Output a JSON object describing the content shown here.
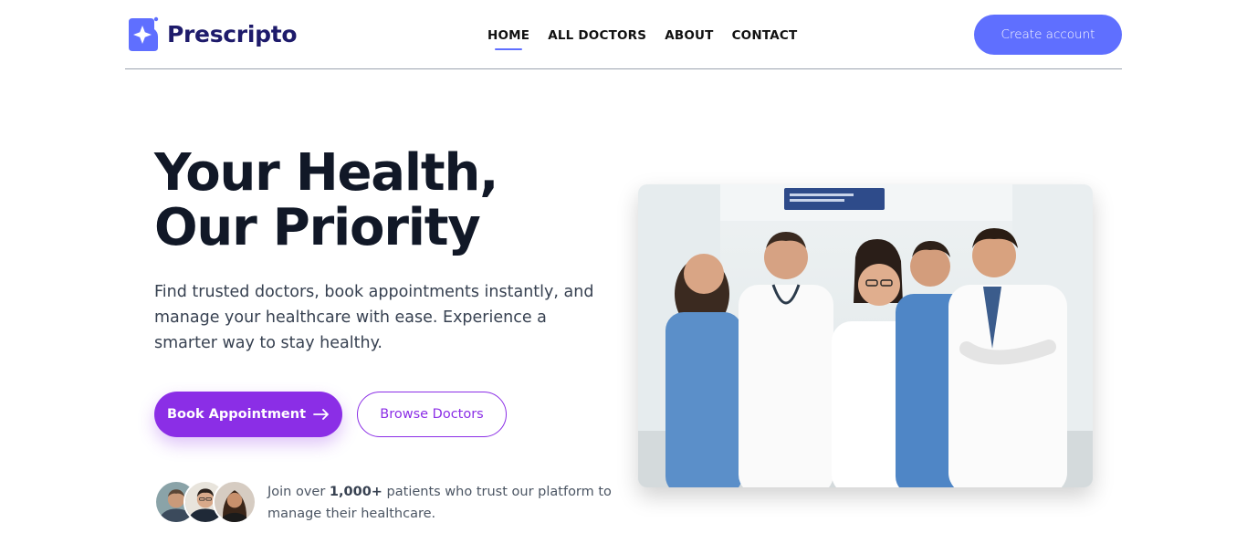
{
  "brand": {
    "name": "Prescripto",
    "logo_icon": "star-badge-icon",
    "primary_color": "#5f6fff",
    "accent_color": "#8b2ee6"
  },
  "nav": {
    "links": [
      {
        "label": "HOME",
        "active": true
      },
      {
        "label": "ALL DOCTORS",
        "active": false
      },
      {
        "label": "ABOUT",
        "active": false
      },
      {
        "label": "CONTACT",
        "active": false
      }
    ],
    "create_account_label": "Create account"
  },
  "hero": {
    "title_line1": "Your Health,",
    "title_line2": "Our Priority",
    "description": "Find trusted doctors, book appointments instantly, and manage your healthcare with ease. Experience a smarter way to stay healthy.",
    "primary_cta_label": "Book Appointment",
    "primary_cta_icon": "arrow-right-icon",
    "secondary_cta_label": "Browse Doctors",
    "trust_prefix": "Join over ",
    "trust_count": "1,000+",
    "trust_suffix": " patients who trust our platform to manage their healthcare.",
    "image_alt": "medical-team-photo"
  }
}
